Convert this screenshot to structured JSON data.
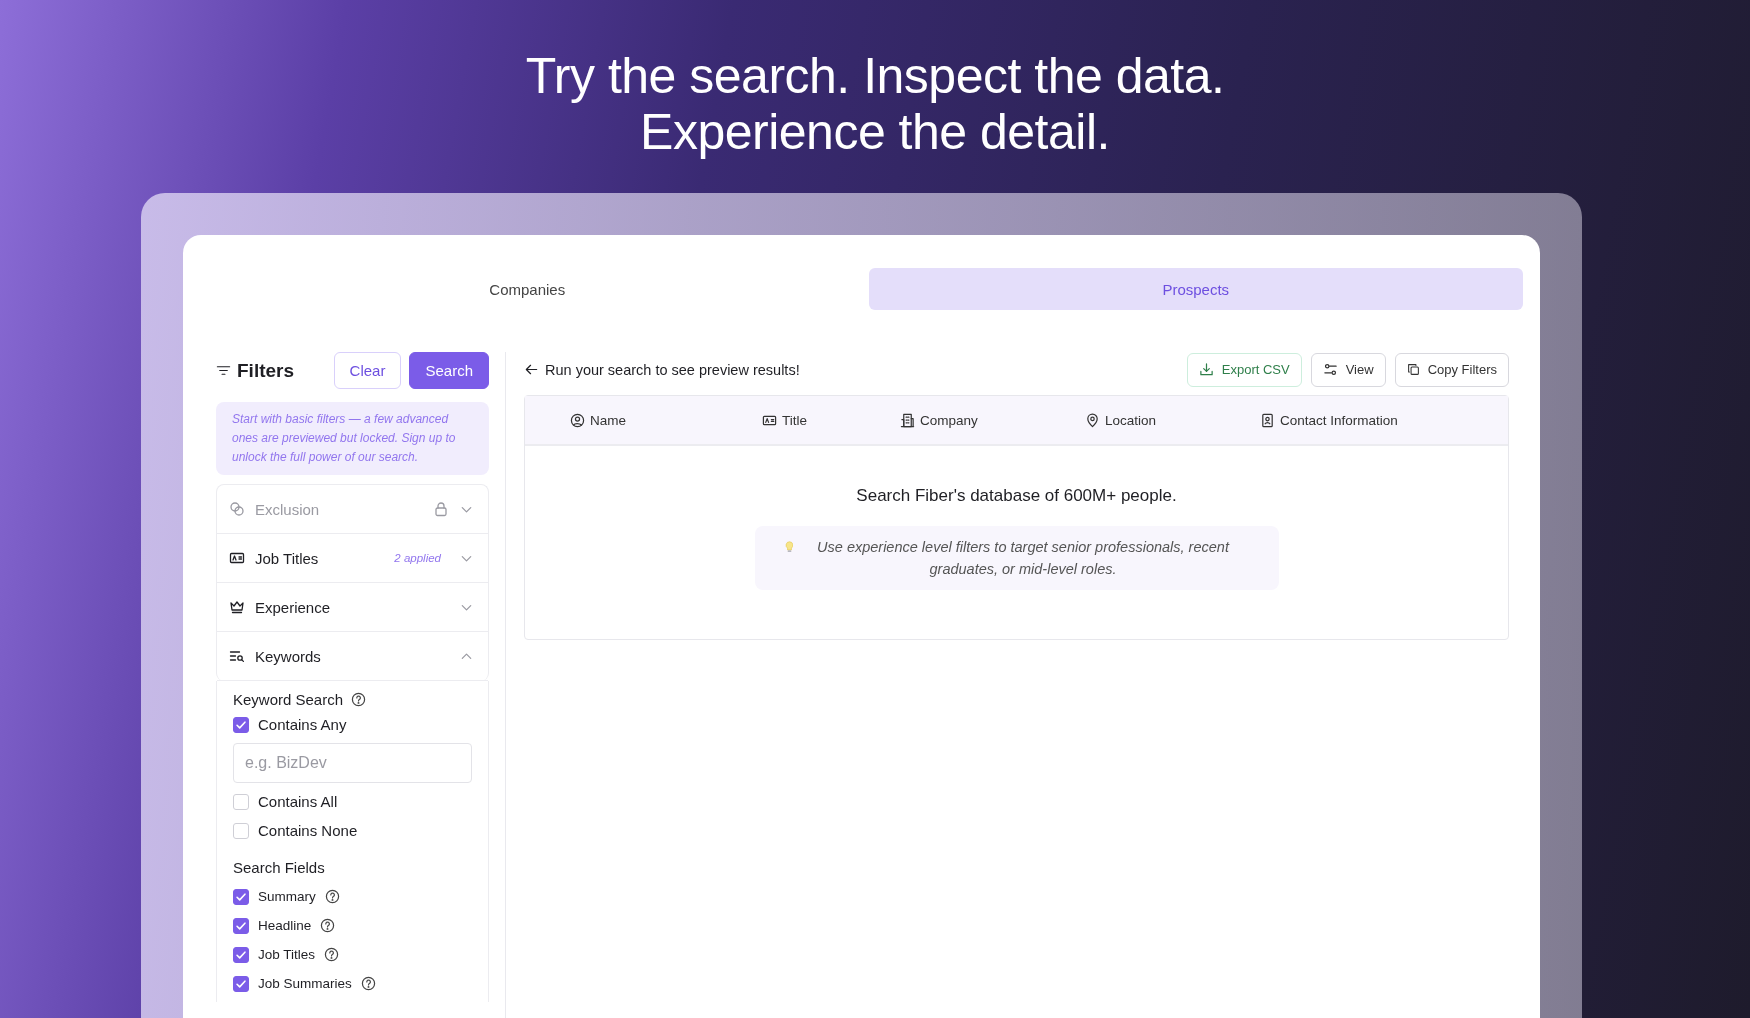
{
  "headline": [
    "Try the search. Inspect the data.",
    "Experience the detail."
  ],
  "tabs": [
    {
      "label": "Companies",
      "selected": false
    },
    {
      "label": "Prospects",
      "selected": true
    }
  ],
  "filters": {
    "title": "Filters",
    "clear": "Clear",
    "search": "Search",
    "notice": "Start with basic filters — a few advanced ones are previewed but locked. Sign up to unlock the full power of our search.",
    "sections": [
      {
        "label": "Exclusion",
        "locked": true,
        "expanded": false
      },
      {
        "label": "Job Titles",
        "locked": false,
        "badge": "2 applied",
        "expanded": false
      },
      {
        "label": "Experience",
        "locked": false,
        "expanded": false
      },
      {
        "label": "Keywords",
        "locked": false,
        "expanded": true
      }
    ],
    "keyword_search": {
      "label": "Keyword Search",
      "placeholder": "e.g. BizDev",
      "options": [
        {
          "label": "Contains Any",
          "checked": true
        },
        {
          "label": "Contains All",
          "checked": false
        },
        {
          "label": "Contains None",
          "checked": false
        }
      ]
    },
    "search_fields": {
      "label": "Search Fields",
      "items": [
        {
          "label": "Summary",
          "checked": true
        },
        {
          "label": "Headline",
          "checked": true
        },
        {
          "label": "Job Titles",
          "checked": true
        },
        {
          "label": "Job Summaries",
          "checked": true
        }
      ]
    }
  },
  "results": {
    "back": "Run your search to see preview results!",
    "actions": [
      "Export CSV",
      "View",
      "Copy Filters"
    ],
    "columns": [
      "Name",
      "Title",
      "Company",
      "Location",
      "Contact Information"
    ],
    "empty_title": "Search Fiber's database of 600M+ people.",
    "tip": "Use experience level filters to target senior professionals, recent graduates, or mid-level roles."
  }
}
